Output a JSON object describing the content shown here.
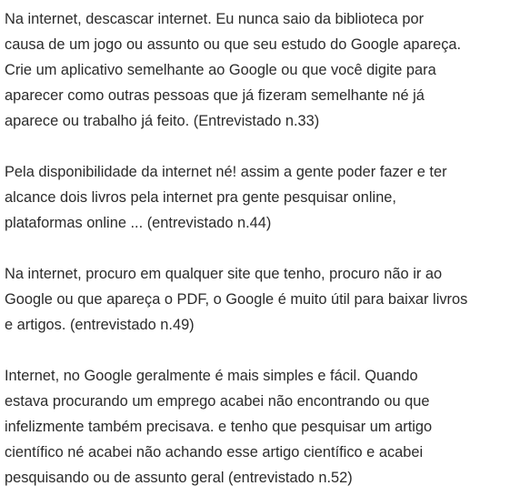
{
  "quotes": [
    {
      "lines": [
        "Na internet, descascar internet. Eu nunca saio da biblioteca por",
        "causa de um jogo ou assunto ou que seu estudo do Google apareça.",
        "Crie um aplicativo semelhante ao Google ou que você digite para",
        "aparecer como outras pessoas que já fizeram semelhante né já",
        "aparece ou trabalho já feito. (Entrevistado n.33)"
      ]
    },
    {
      "lines": [
        "Pela disponibilidade da internet né! assim a gente poder fazer e ter",
        "alcance dois livros pela internet pra gente pesquisar online,",
        "plataformas online ... (entrevistado n.44)"
      ]
    },
    {
      "lines": [
        "Na internet, procuro em qualquer site que tenho, procuro não ir ao",
        "Google ou que apareça o PDF, o Google é muito útil para baixar livros",
        "e artigos. (entrevistado n.49)"
      ]
    },
    {
      "lines": [
        "Internet, no Google geralmente é mais simples e fácil. Quando",
        "estava procurando um emprego acabei não encontrando ou que",
        "infelizmente também precisava. e tenho que pesquisar um artigo",
        "científico né acabei não achando esse artigo científico e acabei",
        "pesquisando ou de assunto geral (entrevistado n.52)"
      ]
    }
  ]
}
